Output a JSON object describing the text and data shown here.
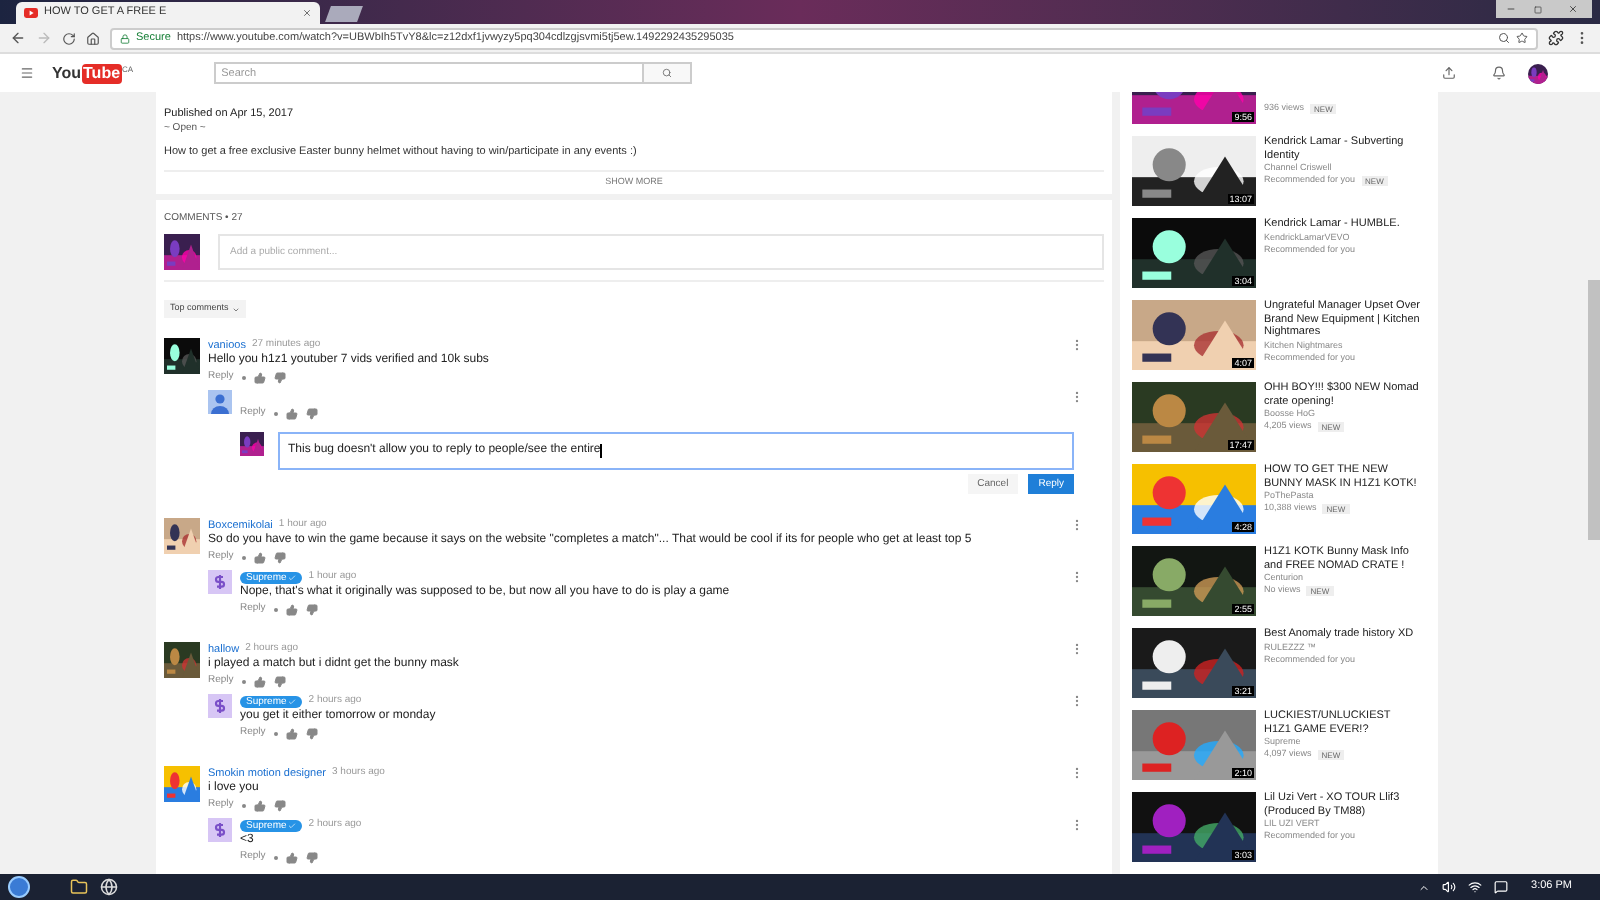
{
  "browser": {
    "tab_title": "HOW TO GET A FREE E",
    "secure_label": "Secure",
    "url": "https://www.youtube.com/watch?v=UBWbIh5TvY8&lc=z12dxf1jvwyzy5pq304cdlzgjsvmi5tj5ew.1492292435295035"
  },
  "youtube_header": {
    "logo_you": "You",
    "logo_tube": "Tube",
    "region": "CA",
    "search_placeholder": "Search"
  },
  "description": {
    "published": "Published on Apr 15, 2017",
    "open_line": "~ Open ~",
    "text": "How to get a free exclusive Easter bunny helmet without having to win/participate in any events :)",
    "show_more": "SHOW MORE"
  },
  "comments": {
    "header": "COMMENTS • 27",
    "placeholder": "Add a public comment...",
    "sort": "Top comments",
    "threads": [
      {
        "author": "vanioos",
        "time": "27 minutes ago",
        "text": "Hello you h1z1 youtuber 7 vids verified and 10k subs",
        "reply_label": "Reply",
        "replies": [
          {
            "reply_label": "Reply",
            "avatar": {
              "kind": "default"
            },
            "reply_box": {
              "value": "This bug doesn't allow you to reply to people/see the entire",
              "cancel": "Cancel",
              "submit": "Reply"
            }
          }
        ]
      },
      {
        "author": "Boxcemikolai",
        "time": "1 hour ago",
        "text": "So do you have to win the game because it says on the website \"completes a match\"... That would be cool if its for people who get at least top 5",
        "reply_label": "Reply",
        "replies": [
          {
            "author": "Supreme",
            "owner": true,
            "time": "1 hour ago",
            "text": "Nope, that's what it originally was supposed to be, but now all you have to do is play a game",
            "reply_label": "Reply",
            "avatar": {
              "kind": "channel"
            }
          }
        ]
      },
      {
        "author": "hallow",
        "time": "2 hours ago",
        "text": "i played a match but i didnt get the bunny mask",
        "reply_label": "Reply",
        "replies": [
          {
            "author": "Supreme",
            "owner": true,
            "time": "2 hours ago",
            "text": "you get it either tomorrow or monday",
            "reply_label": "Reply",
            "avatar": {
              "kind": "channel"
            }
          }
        ]
      },
      {
        "author": "Smokin motion designer",
        "time": "3 hours ago",
        "text": "i love you",
        "reply_label": "Reply",
        "replies": [
          {
            "author": "Supreme",
            "owner": true,
            "time": "2 hours ago",
            "text": "<3",
            "reply_label": "Reply",
            "avatar": {
              "kind": "channel"
            }
          }
        ]
      }
    ]
  },
  "sidebar": {
    "videos": [
      {
        "duration": "9:56",
        "meta": "936 views",
        "badge": "NEW"
      },
      {
        "title": "Kendrick Lamar - Subverting Identity",
        "channel": "Channel Criswell",
        "meta": "Recommended for you",
        "badge": "NEW",
        "duration": "13:07"
      },
      {
        "title": "Kendrick Lamar - HUMBLE.",
        "channel": "KendrickLamarVEVO",
        "meta": "Recommended for you",
        "duration": "3:04"
      },
      {
        "title": "Ungrateful Manager Upset Over Brand New Equipment | Kitchen Nightmares",
        "channel": "Kitchen Nightmares",
        "meta": "Recommended for you",
        "duration": "4:07"
      },
      {
        "title": "OHH BOY!!! $300 NEW Nomad crate opening!",
        "channel": "Boosse HoG",
        "meta": "4,205 views",
        "badge": "NEW",
        "duration": "17:47"
      },
      {
        "title": "HOW TO GET THE NEW BUNNY MASK IN H1Z1 KOTK!",
        "channel": "PoThePasta",
        "meta": "10,388 views",
        "badge": "NEW",
        "duration": "4:28"
      },
      {
        "title": "H1Z1 KOTK Bunny Mask Info and FREE NOMAD CRATE !",
        "channel": "Centurion",
        "meta": "No views",
        "badge": "NEW",
        "duration": "2:55"
      },
      {
        "title": "Best Anomaly trade history XD",
        "channel": "RULEZZZ ™",
        "meta": "Recommended for you",
        "duration": "3:21"
      },
      {
        "title": "LUCKIEST/UNLUCKIEST H1Z1 GAME EVER!?",
        "channel": "Supreme",
        "meta": "4,097 views",
        "badge": "NEW",
        "duration": "2:10"
      },
      {
        "title": "Lil Uzi Vert - XO TOUR Llif3 (Produced By TM88)",
        "channel": "LIL UZI VERT",
        "meta": "Recommended for you",
        "duration": "3:03"
      }
    ]
  },
  "taskbar": {
    "clock": "3:06 PM"
  }
}
